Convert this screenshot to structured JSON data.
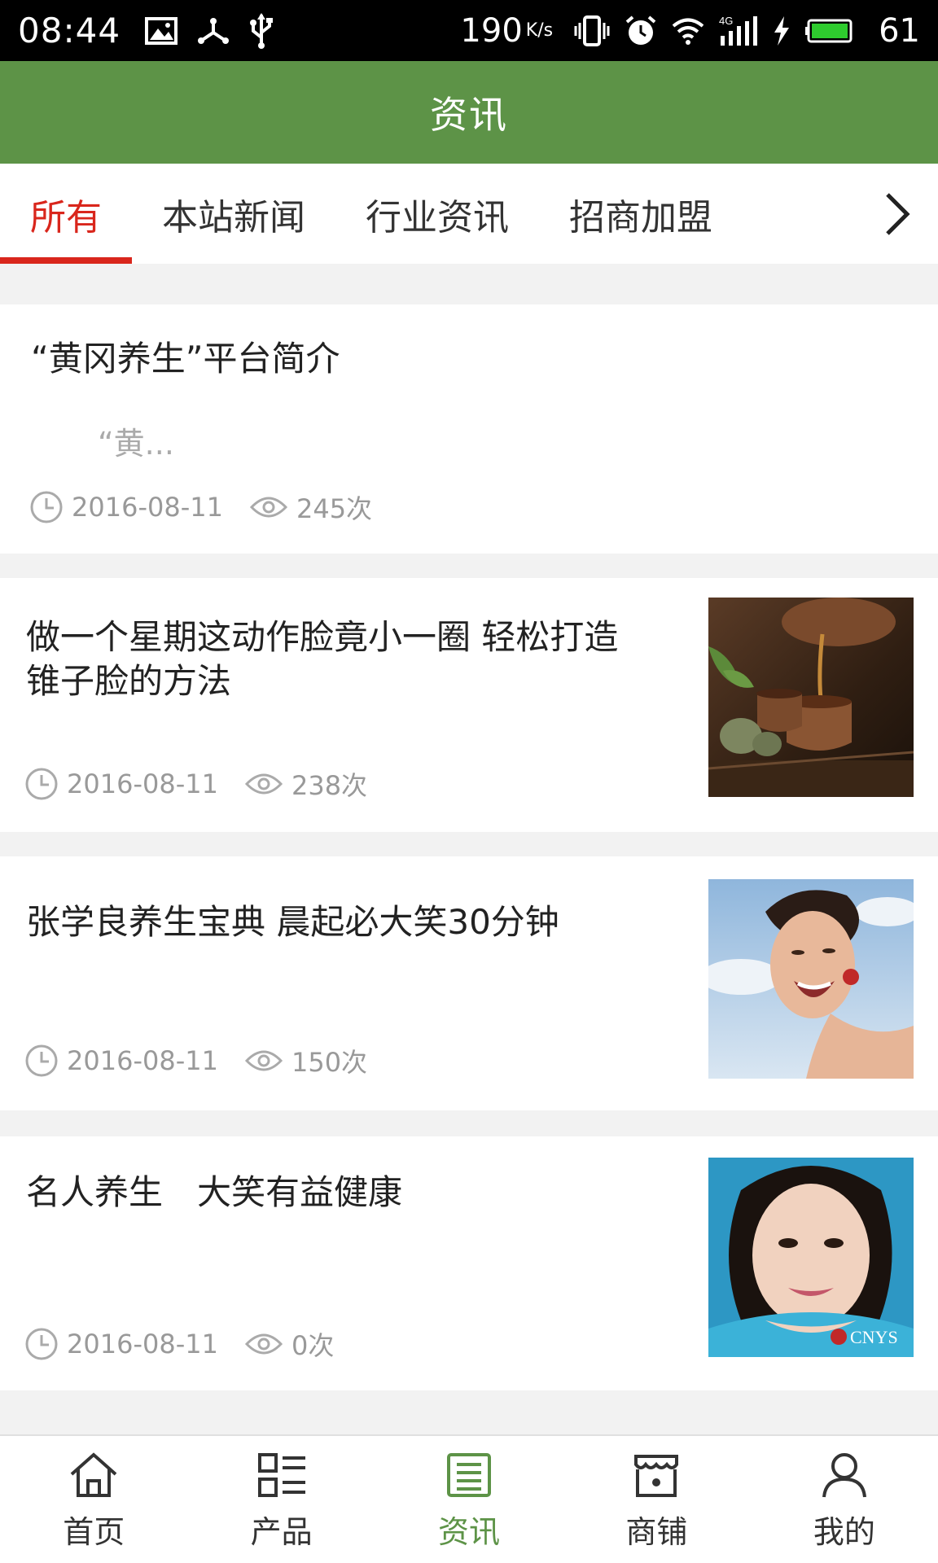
{
  "status_bar": {
    "time": "08:44",
    "speed": "190",
    "speed_unit": "K/s",
    "battery": "61",
    "icons": [
      "image-icon",
      "share-icon",
      "usb-icon",
      "vibrate-icon",
      "alarm-icon",
      "wifi-icon",
      "signal-4g-icon",
      "charging-icon",
      "battery-icon"
    ]
  },
  "header": {
    "title": "资讯"
  },
  "tabs": [
    {
      "label": "所有",
      "active": true
    },
    {
      "label": "本站新闻",
      "active": false
    },
    {
      "label": "行业资讯",
      "active": false
    },
    {
      "label": "招商加盟",
      "active": false
    }
  ],
  "articles": [
    {
      "title": "“黄冈养生”平台简介",
      "summary": "“黄...",
      "date": "2016-08-11",
      "views": "245次",
      "has_image": false
    },
    {
      "title_line1": "做一个星期这动作脸竟小一圈 轻松打造",
      "title_line2": "锥子脸的方法",
      "date": "2016-08-11",
      "views": "238次",
      "has_image": true,
      "image": "tea-pouring-photo"
    },
    {
      "title": "张学良养生宝典 晨起必大笑30分钟",
      "date": "2016-08-11",
      "views": "150次",
      "has_image": true,
      "image": "laughing-woman-photo"
    },
    {
      "title": "名人养生　大笑有益健康",
      "date": "2016-08-11",
      "views": "0次",
      "has_image": true,
      "image": "smiling-woman-photo",
      "image_watermark": "CNYS"
    }
  ],
  "bottom_nav": [
    {
      "label": "首页",
      "icon": "home-icon",
      "active": false
    },
    {
      "label": "产品",
      "icon": "grid-list-icon",
      "active": false
    },
    {
      "label": "资讯",
      "icon": "news-icon",
      "active": true
    },
    {
      "label": "商铺",
      "icon": "shop-icon",
      "active": false
    },
    {
      "label": "我的",
      "icon": "user-icon",
      "active": false
    }
  ],
  "colors": {
    "brand_green": "#5d9347",
    "accent_red": "#d9261c"
  }
}
